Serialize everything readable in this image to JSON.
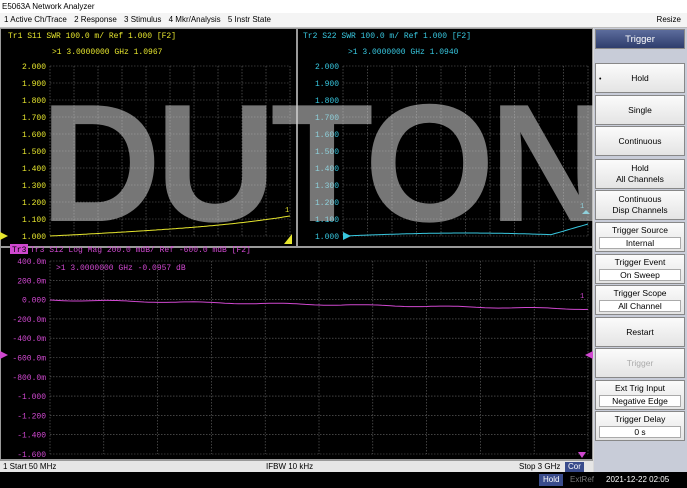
{
  "window": {
    "title": "E5063A Network Analyzer",
    "resize_label": "Resize"
  },
  "menu": [
    {
      "label": "1 Active Ch/Trace"
    },
    {
      "label": "2 Response"
    },
    {
      "label": "3 Stimulus"
    },
    {
      "label": "4 Mkr/Analysis"
    },
    {
      "label": "5 Instr State"
    }
  ],
  "colors": {
    "tr1": "#e6e62e",
    "tr2": "#38c8e0",
    "tr3": "#d048d0",
    "grid": "#7a7a7a"
  },
  "trace1": {
    "header": "Tr1 S11  SWR 100.0 m/ Ref 1.000  [F2]",
    "marker": ">1   3.0000000 GHz  1.0967",
    "y_ticks": [
      "2.000",
      "1.900",
      "1.800",
      "1.700",
      "1.600",
      "1.500",
      "1.400",
      "1.300",
      "1.200",
      "1.100",
      "1.000"
    ]
  },
  "trace2": {
    "header": "Tr2 S22  SWR 100.0 m/ Ref 1.000  [F2]",
    "marker": ">1   3.0000000 GHz  1.0940",
    "y_ticks": [
      "2.000",
      "1.900",
      "1.800",
      "1.700",
      "1.600",
      "1.500",
      "1.400",
      "1.300",
      "1.200",
      "1.100",
      "1.000"
    ]
  },
  "trace3": {
    "header": "Tr3  S12 Log Mag 200.0 mdB/ Ref -600.0 mdB [F2]",
    "tag": "Tr3",
    "marker": ">1   3.0000000 GHz  -0.0957 dB",
    "y_ticks": [
      "400.0m",
      "200.0m",
      "0.000",
      "-200.0m",
      "-400.0m",
      "-600.0m",
      "-800.0m",
      "-1.000",
      "-1.200",
      "-1.400",
      "-1.600"
    ]
  },
  "watermark": "DUTON",
  "status": {
    "start": "1  Start 50 MHz",
    "ifbw": "IFBW 10 kHz",
    "stop": "Stop 3 GHz",
    "cor": "Cor"
  },
  "bottom": {
    "hold": "Hold",
    "extref": "ExtRef",
    "datetime": "2021-12-22 02:05"
  },
  "softkeys": {
    "title": "Trigger",
    "hold": "Hold",
    "single": "Single",
    "continuous": "Continuous",
    "hold_all_1": "Hold",
    "hold_all_2": "All Channels",
    "cont_disp_1": "Continuous",
    "cont_disp_2": "Disp Channels",
    "source_label": "Trigger Source",
    "source_value": "Internal",
    "event_label": "Trigger Event",
    "event_value": "On Sweep",
    "scope_label": "Trigger Scope",
    "scope_value": "All Channel",
    "restart": "Restart",
    "trigger": "Trigger",
    "ext_trig_label": "Ext Trig Input",
    "ext_trig_value": "Negative Edge",
    "delay_label": "Trigger Delay",
    "delay_value": "0 s"
  }
}
